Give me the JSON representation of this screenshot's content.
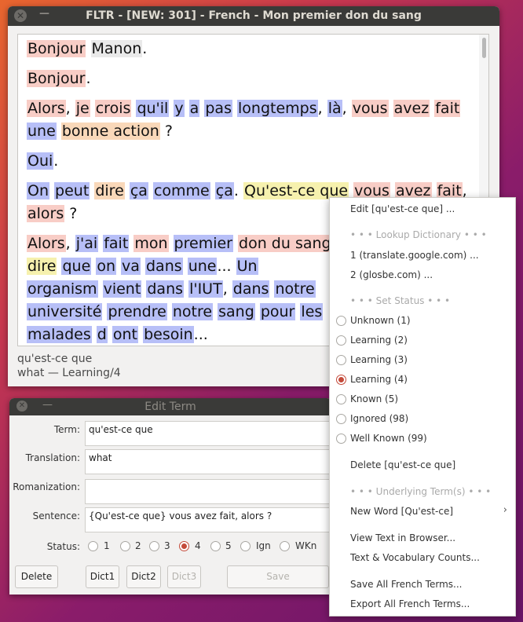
{
  "main_window": {
    "title": "FLTR - [NEW: 301] - French - Mon premier don du sang",
    "status_term": "qu'est-ce que",
    "status_info": "what — Learning/4"
  },
  "text": {
    "p1": [
      [
        "Bonjour",
        "l2"
      ],
      [
        " ",
        ""
      ],
      [
        "Manon",
        "k"
      ],
      [
        ".",
        ""
      ]
    ],
    "p2": [
      [
        "Bonjour",
        "l2"
      ],
      [
        ".",
        ""
      ]
    ],
    "p3": [
      [
        "Alors",
        "l2"
      ],
      [
        ", ",
        ""
      ],
      [
        "je",
        "l2"
      ],
      [
        " ",
        ""
      ],
      [
        "crois",
        "l2"
      ],
      [
        " ",
        ""
      ],
      [
        "qu'il",
        "u"
      ],
      [
        " ",
        ""
      ],
      [
        "y",
        "u"
      ],
      [
        " ",
        ""
      ],
      [
        "a",
        "u"
      ],
      [
        " ",
        ""
      ],
      [
        "pas",
        "u"
      ],
      [
        " ",
        ""
      ],
      [
        "longtemps",
        "u"
      ],
      [
        ", ",
        ""
      ],
      [
        "là",
        "u"
      ],
      [
        ", ",
        ""
      ],
      [
        "vous",
        "l2"
      ],
      [
        " ",
        ""
      ],
      [
        "avez",
        "l2"
      ],
      [
        " ",
        ""
      ],
      [
        "fait",
        "l2"
      ],
      [
        " ",
        ""
      ],
      [
        "une",
        "u"
      ],
      [
        " ",
        ""
      ],
      [
        "bonne action",
        "l3"
      ],
      [
        " ?",
        ""
      ]
    ],
    "p4": [
      [
        "Oui",
        "u"
      ],
      [
        ".",
        ""
      ]
    ],
    "p5": [
      [
        "On",
        "u"
      ],
      [
        " ",
        ""
      ],
      [
        "peut",
        "u"
      ],
      [
        " ",
        ""
      ],
      [
        "dire",
        "l3"
      ],
      [
        " ",
        ""
      ],
      [
        "ça",
        "u"
      ],
      [
        " ",
        ""
      ],
      [
        "comme",
        "u"
      ],
      [
        " ",
        ""
      ],
      [
        "ça",
        "u"
      ],
      [
        ". ",
        ""
      ],
      [
        "Qu'est-ce que",
        "l4"
      ],
      [
        " ",
        ""
      ],
      [
        "vous",
        "l2"
      ],
      [
        " ",
        ""
      ],
      [
        "avez",
        "l2"
      ],
      [
        " ",
        ""
      ],
      [
        "fait",
        "l2"
      ],
      [
        ", ",
        ""
      ],
      [
        "alors",
        "l2"
      ],
      [
        " ?",
        ""
      ]
    ],
    "p6": [
      [
        "Alors",
        "l2"
      ],
      [
        ", ",
        ""
      ],
      [
        "j'ai",
        "u"
      ],
      [
        " ",
        ""
      ],
      [
        "fait",
        "u"
      ],
      [
        " ",
        ""
      ],
      [
        "mon",
        "l2"
      ],
      [
        " ",
        ""
      ],
      [
        "premier",
        "u"
      ],
      [
        " ",
        ""
      ],
      [
        "don du sang",
        "l2"
      ],
      [
        " ",
        ""
      ],
      [
        "dire",
        "l4"
      ],
      [
        " ",
        ""
      ],
      [
        "que",
        "u"
      ],
      [
        " ",
        ""
      ],
      [
        "on",
        "u"
      ],
      [
        " ",
        ""
      ],
      [
        "va",
        "u"
      ],
      [
        " ",
        ""
      ],
      [
        "dans",
        "u"
      ],
      [
        " ",
        ""
      ],
      [
        "une",
        "u"
      ],
      [
        "... ",
        ""
      ],
      [
        "Un",
        "u"
      ],
      [
        " ",
        ""
      ],
      [
        "organism",
        "u"
      ],
      [
        " ",
        ""
      ],
      [
        "vient",
        "u"
      ],
      [
        " ",
        ""
      ],
      [
        "dans",
        "u"
      ],
      [
        " ",
        ""
      ],
      [
        "l'IUT",
        "u"
      ],
      [
        ", ",
        ""
      ],
      [
        "dans",
        "u"
      ],
      [
        " ",
        ""
      ],
      [
        "notre",
        "u"
      ],
      [
        " ",
        ""
      ],
      [
        "université",
        "u"
      ],
      [
        " ",
        ""
      ],
      [
        "prendre",
        "u"
      ],
      [
        " ",
        ""
      ],
      [
        "notre",
        "u"
      ],
      [
        " ",
        ""
      ],
      [
        "sang",
        "u"
      ],
      [
        " ",
        ""
      ],
      [
        "pour",
        "u"
      ],
      [
        " ",
        ""
      ],
      [
        "les",
        "u"
      ],
      [
        " ",
        ""
      ],
      [
        "malades",
        "u"
      ],
      [
        " ",
        ""
      ],
      [
        "d",
        "u"
      ],
      [
        " ",
        ""
      ],
      [
        "ont",
        "u"
      ],
      [
        " ",
        ""
      ],
      [
        "besoin",
        "u"
      ],
      [
        "...",
        ""
      ]
    ]
  },
  "edit_window": {
    "title": "Edit Term",
    "term_label": "Term:",
    "term_value": "qu'est-ce que",
    "translation_label": "Translation:",
    "translation_value": "what",
    "romanization_label": "Romanization:",
    "romanization_value": "",
    "sentence_label": "Sentence:",
    "sentence_value": "{Qu'est-ce que} vous avez fait, alors ?",
    "status_label": "Status:",
    "status_options": [
      "1",
      "2",
      "3",
      "4",
      "5",
      "Ign",
      "WKn"
    ],
    "selected_status": "4",
    "buttons": {
      "delete": "Delete",
      "dict1": "Dict1",
      "dict2": "Dict2",
      "dict3": "Dict3",
      "save": "Save"
    }
  },
  "context_menu": {
    "edit": "Edit [qu'est-ce que] ...",
    "lookup_header": "• • • Lookup Dictionary • • •",
    "dict1": "1 (translate.google.com) ...",
    "dict2": "2 (glosbe.com) ...",
    "status_header": "• • • Set Status • • •",
    "statuses": [
      "Unknown (1)",
      "Learning (2)",
      "Learning (3)",
      "Learning (4)",
      "Known (5)",
      "Ignored (98)",
      "Well Known (99)"
    ],
    "selected_status": "Learning (4)",
    "delete": "Delete [qu'est-ce que]",
    "underlying_header": "• • • Underlying Term(s) • • •",
    "new_word": "New Word [Qu'est-ce]",
    "view_text": "View Text in Browser...",
    "counts": "Text & Vocabulary Counts...",
    "save_all": "Save All French Terms...",
    "export_all": "Export All French Terms..."
  }
}
